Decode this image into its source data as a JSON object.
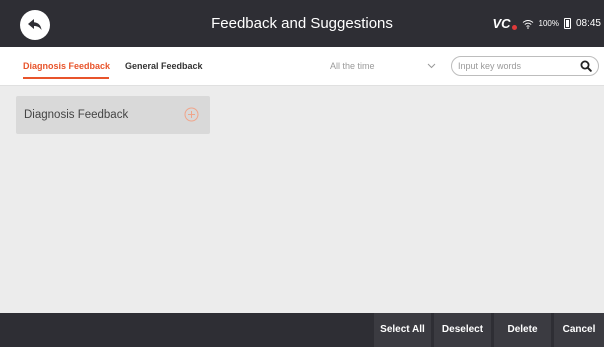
{
  "header": {
    "title": "Feedback and Suggestions",
    "status": {
      "vci_label": "VCI",
      "battery": "100%",
      "time": "08:45"
    }
  },
  "tabs": [
    {
      "label": "Diagnosis Feedback",
      "active": true
    },
    {
      "label": "General Feedback",
      "active": false
    }
  ],
  "filter": {
    "time_range": "All the time"
  },
  "search": {
    "placeholder": "Input key words",
    "value": ""
  },
  "list": {
    "items": [
      {
        "label": "Diagnosis Feedback"
      }
    ]
  },
  "actions": {
    "select_all": "Select All",
    "deselect": "Deselect",
    "delete": "Delete",
    "cancel": "Cancel"
  },
  "colors": {
    "accent": "#e8542b",
    "bar_background": "#2e2e34",
    "page_background": "#ececec",
    "card_background": "#d9d9d9"
  }
}
